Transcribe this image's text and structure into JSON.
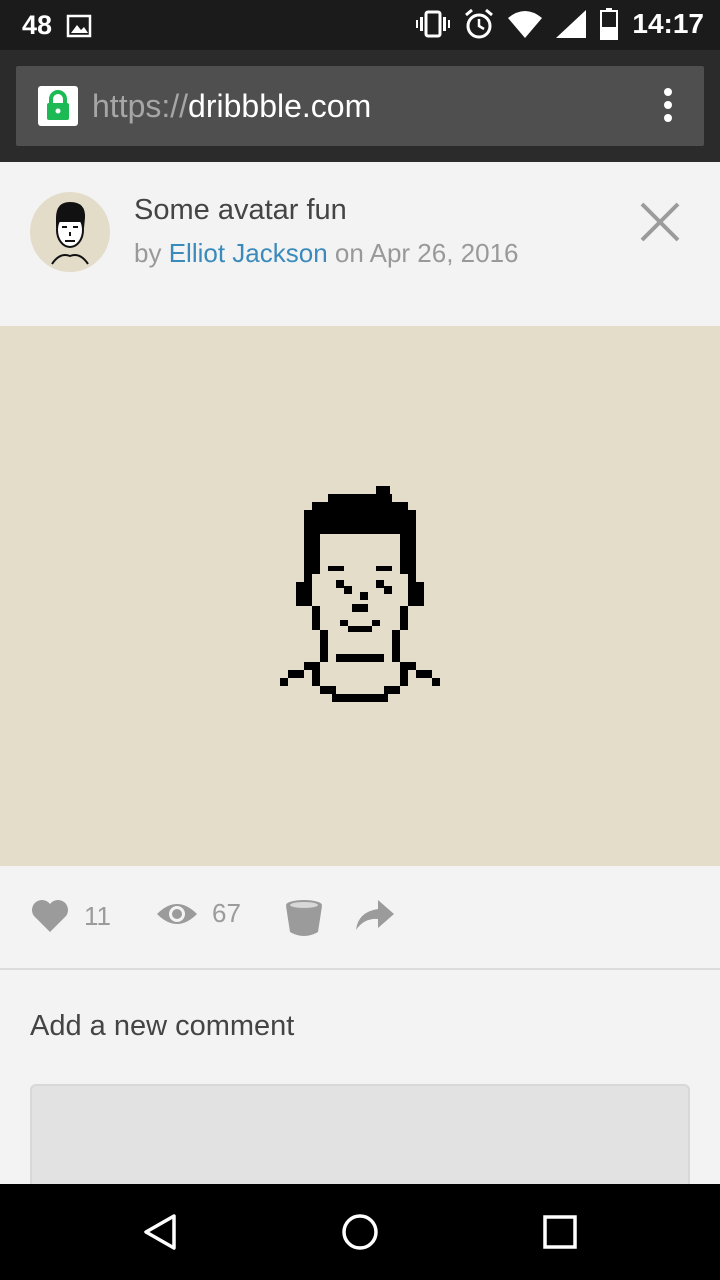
{
  "status_bar": {
    "notification_count": "48",
    "time": "14:17",
    "icons": [
      "image-icon",
      "vibrate-icon",
      "alarm-icon",
      "wifi-icon",
      "signal-icon",
      "battery-icon"
    ]
  },
  "browser": {
    "url_scheme": "https://",
    "url_host": "dribbble.com"
  },
  "shot": {
    "title": "Some avatar fun",
    "by_label": "by",
    "author": "Elliot Jackson",
    "on_label": "on",
    "date": "Apr 26, 2016"
  },
  "stats": {
    "likes": "11",
    "views": "67"
  },
  "comments": {
    "title": "Add a new comment"
  },
  "colors": {
    "link": "#3a8bbb",
    "image_background": "#e3ddc9",
    "lock_green": "#1db954"
  }
}
